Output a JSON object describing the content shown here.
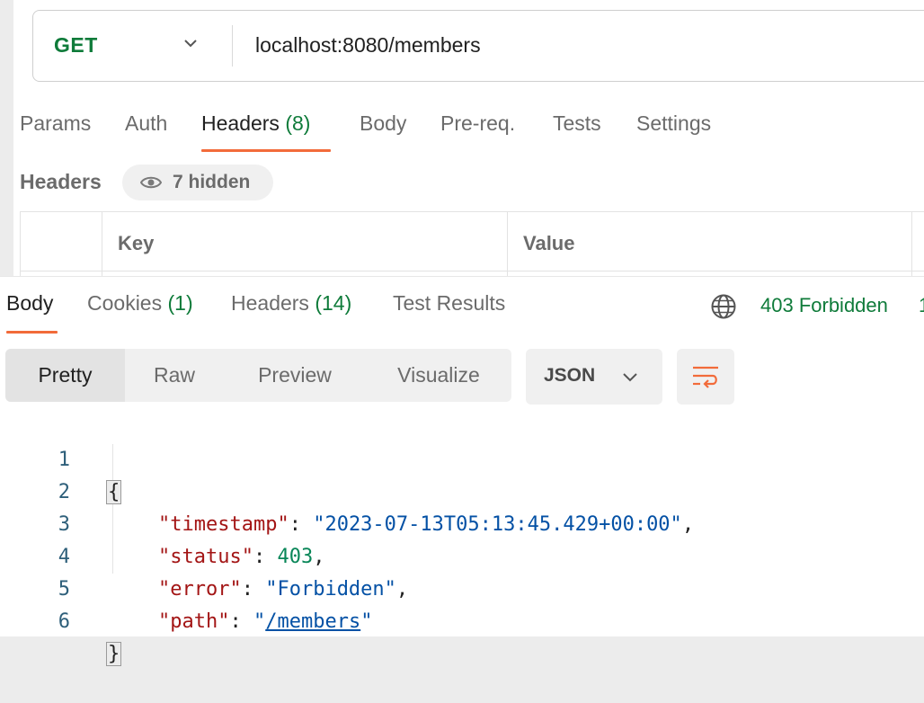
{
  "request": {
    "method": "GET",
    "url": "localhost:8080/members"
  },
  "request_tabs": [
    {
      "label": "Params",
      "count": ""
    },
    {
      "label": "Auth",
      "count": ""
    },
    {
      "label": "Headers",
      "count": "(8)"
    },
    {
      "label": "Body",
      "count": ""
    },
    {
      "label": "Pre-req.",
      "count": ""
    },
    {
      "label": "Tests",
      "count": ""
    },
    {
      "label": "Settings",
      "count": ""
    }
  ],
  "headers_section": {
    "title": "Headers",
    "hidden_label": "7 hidden",
    "columns": [
      "Key",
      "Value"
    ]
  },
  "response_tabs": [
    {
      "label": "Body",
      "count": ""
    },
    {
      "label": "Cookies",
      "count": "(1)"
    },
    {
      "label": "Headers",
      "count": "(14)"
    },
    {
      "label": "Test Results",
      "count": ""
    }
  ],
  "response_status": "403 Forbidden",
  "response_status_extra": "1",
  "view_options": [
    "Pretty",
    "Raw",
    "Preview",
    "Visualize"
  ],
  "format": "JSON",
  "code_lines": [
    {
      "n": "1"
    },
    {
      "n": "2",
      "key": "\"timestamp\"",
      "value": "\"2023-07-13T05:13:45.429+00:00\""
    },
    {
      "n": "3",
      "key": "\"status\"",
      "value": "403"
    },
    {
      "n": "4",
      "key": "\"error\"",
      "value": "\"Forbidden\""
    },
    {
      "n": "5",
      "key": "\"path\"",
      "value_q1": "\"",
      "value_link": "/members",
      "value_q2": "\""
    },
    {
      "n": "6"
    }
  ],
  "colors": {
    "accent": "#f26b3a",
    "method_green": "#0f7b3a",
    "status_green": "#0f7b3a",
    "json_key": "#a31515",
    "json_string": "#0451a5",
    "json_number": "#098658"
  },
  "icons": [
    "chevron-down-icon",
    "eye-icon",
    "globe-icon",
    "wrap-lines-icon"
  ]
}
